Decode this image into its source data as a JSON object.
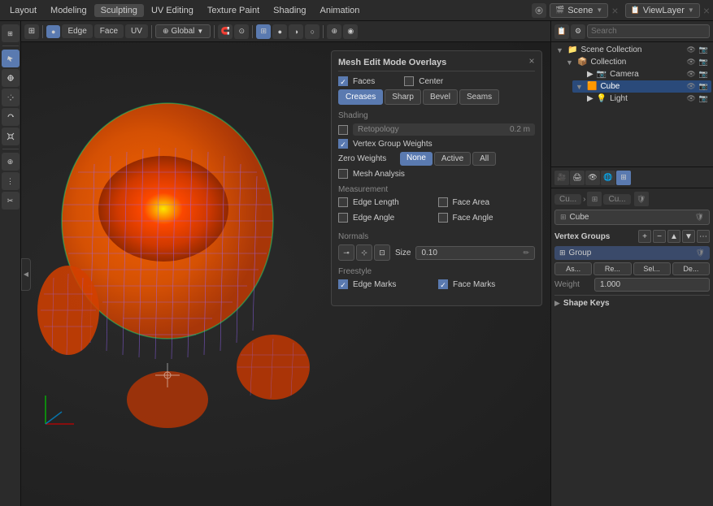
{
  "topMenu": {
    "items": [
      "Layout",
      "Modeling",
      "Sculpting",
      "UV Editing",
      "Texture Paint",
      "Shading",
      "Animation"
    ],
    "active": "UV Editing",
    "scene": "Scene",
    "viewLayer": "ViewLayer"
  },
  "viewportHeader": {
    "edgeBtn": "Edge",
    "faceBtn": "Face",
    "uvBtn": "UV",
    "transformDropdown": "Global",
    "searchPlaceholder": "Search"
  },
  "overlayPanel": {
    "title": "Mesh Edit Mode Overlays",
    "faces": {
      "label": "Faces",
      "checked": true
    },
    "center": {
      "label": "Center",
      "checked": false
    },
    "edgeButtons": [
      "Creases",
      "Sharp",
      "Bevel",
      "Seams"
    ],
    "activeEdge": "Creases",
    "shading": {
      "label": "Shading",
      "retopology": {
        "label": "Retopology",
        "value": "0.2 m",
        "checked": false
      },
      "vertexGroupWeights": {
        "label": "Vertex Group Weights",
        "checked": true
      },
      "zeroWeights": {
        "label": "Zero Weights",
        "options": [
          "None",
          "Active",
          "All"
        ],
        "active": "None"
      },
      "meshAnalysis": {
        "label": "Mesh Analysis",
        "checked": false
      }
    },
    "measurement": {
      "label": "Measurement",
      "edgeLength": {
        "label": "Edge Length",
        "checked": false
      },
      "faceArea": {
        "label": "Face Area",
        "checked": false
      },
      "edgeAngle": {
        "label": "Edge Angle",
        "checked": false
      },
      "faceAngle": {
        "label": "Face Angle",
        "checked": false
      }
    },
    "normals": {
      "label": "Normals",
      "sizeLabel": "Size",
      "sizeValue": "0.10"
    },
    "freestyle": {
      "label": "Freestyle",
      "edgeMarks": {
        "label": "Edge Marks",
        "checked": true
      },
      "faceMarks": {
        "label": "Face Marks",
        "checked": true
      }
    }
  },
  "outliner": {
    "searchPlaceholder": "Search",
    "items": [
      {
        "label": "Scene Collection",
        "icon": "📁",
        "level": 0,
        "expanded": true
      },
      {
        "label": "Collection",
        "icon": "📦",
        "level": 1,
        "expanded": true
      },
      {
        "label": "Camera",
        "icon": "📷",
        "level": 2
      },
      {
        "label": "Cube",
        "icon": "🟧",
        "level": 2,
        "selected": true,
        "expanded": true
      },
      {
        "label": "Light",
        "icon": "💡",
        "level": 2
      }
    ]
  },
  "properties": {
    "breadcrumb": {
      "cu": "Cu...",
      "sep": "›",
      "cube": "Cu..."
    },
    "objectName": "Cube",
    "vertexGroups": {
      "title": "Vertex Groups",
      "items": [
        {
          "name": "Group",
          "icon": "⊞"
        }
      ]
    },
    "weight": {
      "label": "Weight",
      "value": "1.000"
    },
    "actionButtons": [
      "As...",
      "Re...",
      "Sel...",
      "De..."
    ],
    "shapeKeys": {
      "label": "Shape Keys"
    }
  },
  "icons": {
    "arrow_right": "▶",
    "arrow_down": "▼",
    "arrow_left": "◀",
    "eye": "👁",
    "camera": "📷",
    "shield": "🛡",
    "plus": "+",
    "minus": "−",
    "check": "✓",
    "close": "×",
    "search": "🔍",
    "gear": "⚙",
    "cube": "⬜",
    "mesh": "⊞"
  }
}
